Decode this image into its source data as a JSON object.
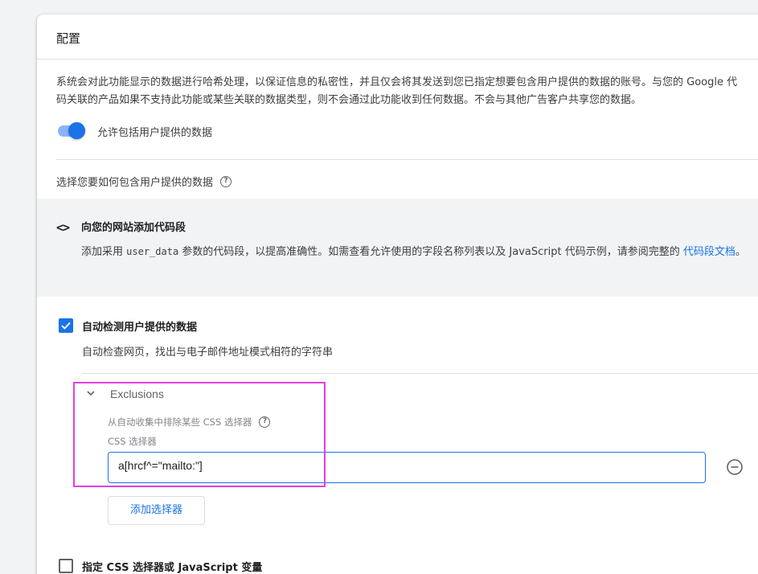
{
  "colors": {
    "accent": "#1a73e8",
    "highlight": "#e040e0",
    "panel_bg": "#f1f3f4"
  },
  "header": {
    "title": "配置"
  },
  "description": "系统会对此功能显示的数据进行哈希处理，以保证信息的私密性，并且仅会将其发送到您已指定想要包含用户提供的数据的账号。与您的 Google 代码关联的产品如果不支持此功能或某些关联的数据类型，则不会通过此功能收到任何数据。不会与其他广告客户共享您的数据。",
  "toggle": {
    "label": "允许包括用户提供的数据",
    "state": "on"
  },
  "choose": {
    "label": "选择您要如何包含用户提供的数据",
    "help_icon": "help-circle-icon"
  },
  "snippet_option": {
    "icon": "code-brackets-icon",
    "icon_text": "<>",
    "title": "向您的网站添加代码段",
    "desc_part1": "添加采用 ",
    "desc_code": "user_data",
    "desc_part2": " 参数的代码段，以提高准确性。如需查看允许使用的字段名称列表以及 JavaScript 代码示例，请参阅完整的 ",
    "desc_link": "代码段文档",
    "desc_part3": "。"
  },
  "auto_detect": {
    "checked": true,
    "label": "自动检测用户提供的数据",
    "desc": "自动检查网页，找出与电子邮件地址模式相符的字符串"
  },
  "exclusions": {
    "expanded": true,
    "title": "Exclusions",
    "subtitle": "从自动收集中排除某些 CSS 选择器",
    "field_label": "CSS 选择器",
    "field_value": "a[hrcf^=\"mailto:\"]",
    "remove_icon": "remove-circle-icon",
    "add_button": "添加选择器"
  },
  "specify": {
    "checked": false,
    "label": "指定 CSS 选择器或 JavaScript 变量"
  }
}
